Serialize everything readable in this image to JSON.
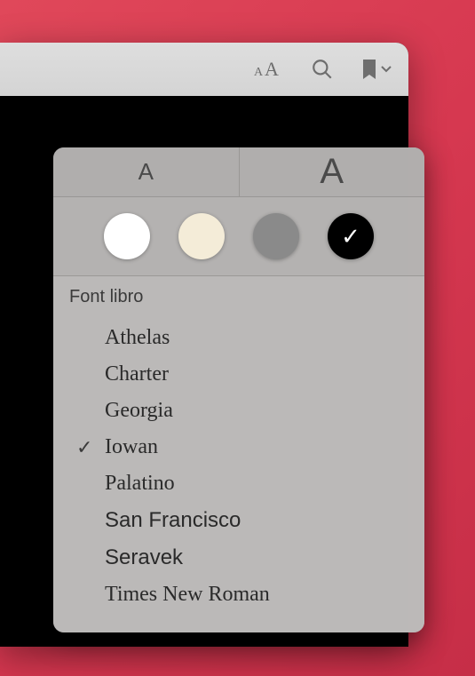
{
  "toolbar": {
    "appearance_icon": "appearance-icon",
    "search_icon": "search-icon",
    "bookmark_icon": "bookmark-icon"
  },
  "size_buttons": {
    "small_label": "A",
    "large_label": "A"
  },
  "themes": {
    "white": "#ffffff",
    "sepia": "#f4ecd8",
    "gray": "#8a8a8a",
    "black": "#000000",
    "selected": "black"
  },
  "font_section": {
    "header": "Font libro",
    "selected": "Iowan",
    "fonts": [
      {
        "name": "Athelas",
        "class": "f-athelas"
      },
      {
        "name": "Charter",
        "class": "f-charter"
      },
      {
        "name": "Georgia",
        "class": "f-georgia"
      },
      {
        "name": "Iowan",
        "class": "f-iowan"
      },
      {
        "name": "Palatino",
        "class": "f-palatino"
      },
      {
        "name": "San Francisco",
        "class": "f-sf"
      },
      {
        "name": "Seravek",
        "class": "f-seravek"
      },
      {
        "name": "Times New Roman",
        "class": "f-times"
      }
    ]
  }
}
